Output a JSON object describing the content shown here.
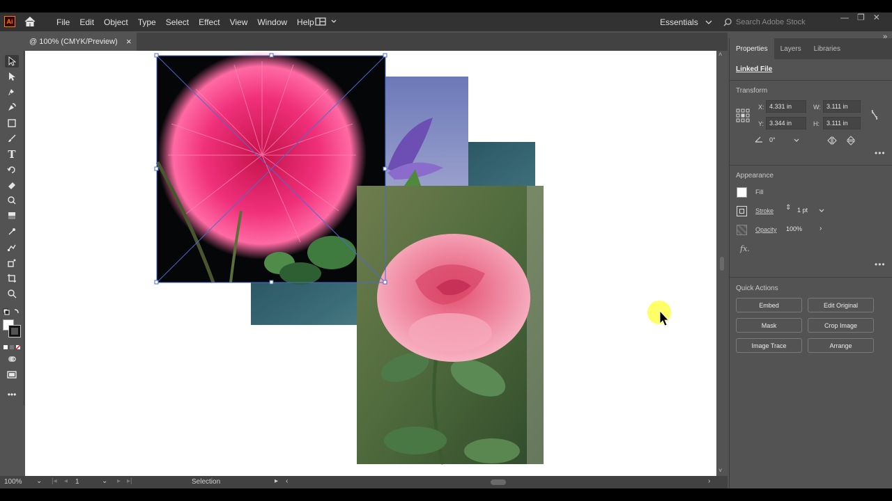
{
  "app": {
    "logo": "Ai",
    "icon": "home-icon"
  },
  "menu": [
    "File",
    "Edit",
    "Object",
    "Type",
    "Select",
    "Effect",
    "View",
    "Window",
    "Help"
  ],
  "workspace": {
    "label": "Essentials"
  },
  "search": {
    "placeholder": "Search Adobe Stock"
  },
  "document": {
    "tab_title": "@ 100% (CMYK/Preview)",
    "close": "×"
  },
  "status": {
    "zoom": "100%",
    "artboard": "1",
    "tool": "Selection"
  },
  "panel": {
    "tabs": [
      "Properties",
      "Layers",
      "Libraries"
    ],
    "linked_file": "Linked File",
    "transform": {
      "title": "Transform",
      "x_label": "X:",
      "x": "4.331 in",
      "y_label": "Y:",
      "y": "3.344 in",
      "w_label": "W:",
      "w": "3.111 in",
      "h_label": "H:",
      "h": "3.111 in",
      "angle": "0°"
    },
    "appearance": {
      "title": "Appearance",
      "fill": "Fill",
      "stroke": "Stroke",
      "stroke_weight": "1 pt",
      "opacity": "Opacity",
      "opacity_value": "100%",
      "fx": "fx."
    },
    "quick_actions": {
      "title": "Quick Actions",
      "buttons": [
        "Embed",
        "Edit Original",
        "Mask",
        "Crop Image",
        "Image Trace",
        "Arrange"
      ]
    }
  },
  "colors": {
    "panel_bg": "#535353",
    "menubar_bg": "#323232",
    "canvas_bg": "#ffffff",
    "selection": "#4a6bd6",
    "cursor_highlight": "#ffff55"
  }
}
